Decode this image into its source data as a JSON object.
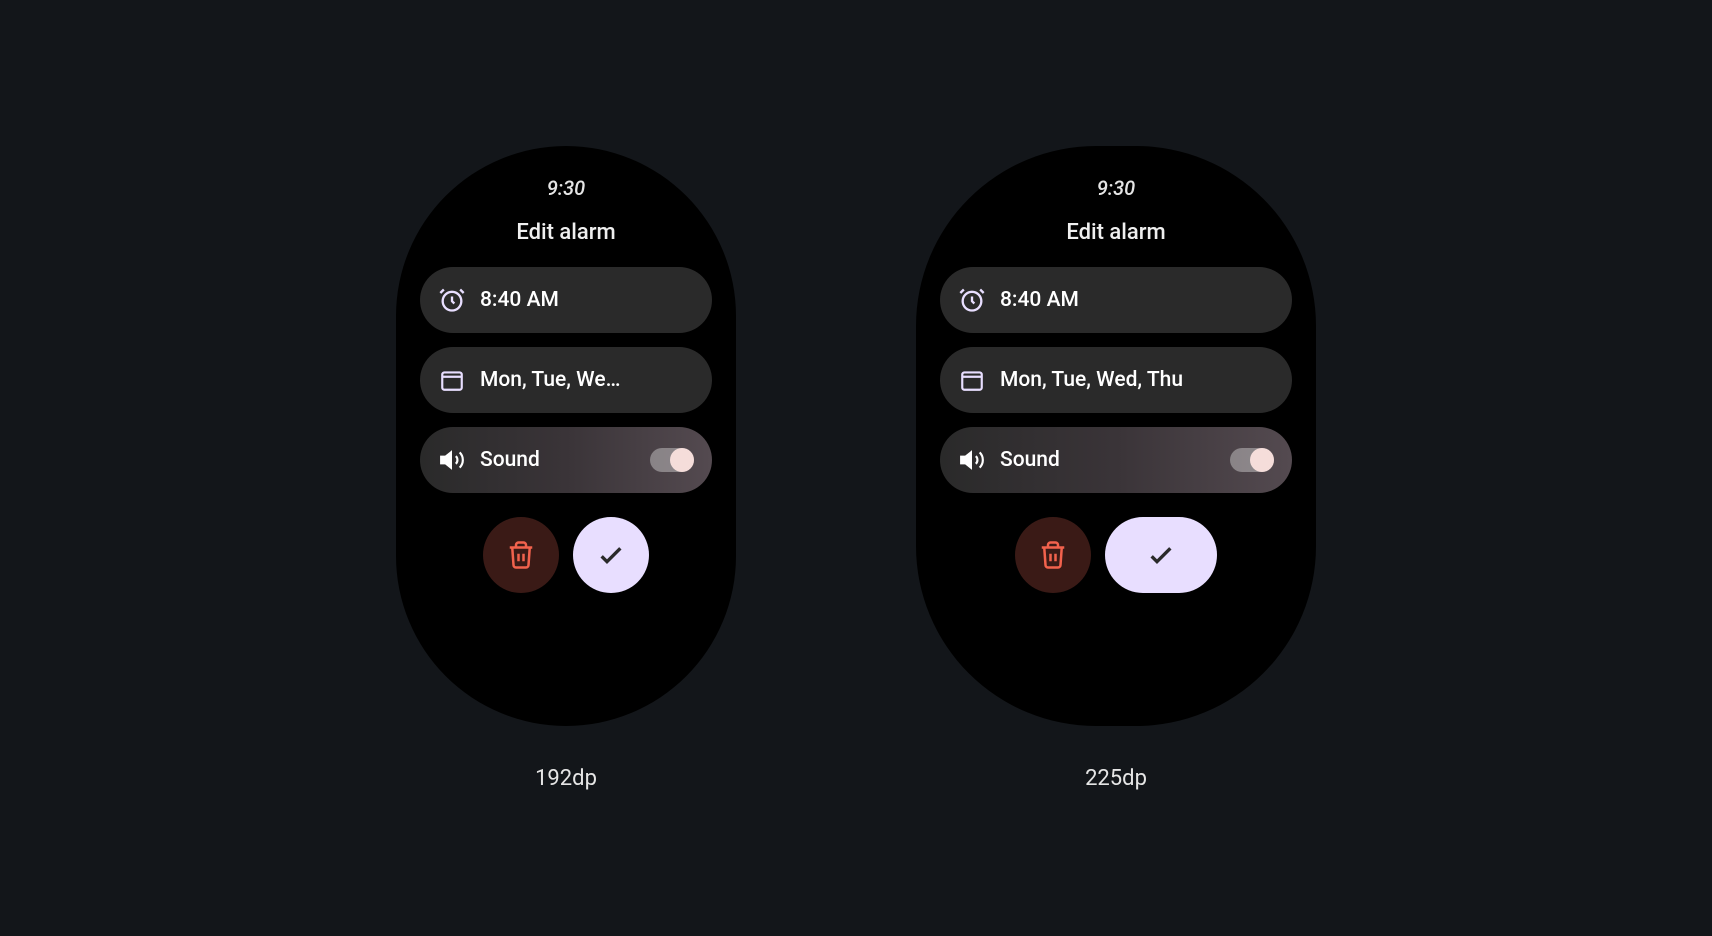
{
  "status_time": "9:30",
  "screen_title": "Edit alarm",
  "alarm": {
    "time": "8:40 AM",
    "repeat_short": "Mon, Tue, We…",
    "repeat_full": "Mon, Tue, Wed, Thu",
    "sound_label": "Sound",
    "sound_on": true
  },
  "sizes": {
    "small": "192dp",
    "large": "225dp"
  }
}
